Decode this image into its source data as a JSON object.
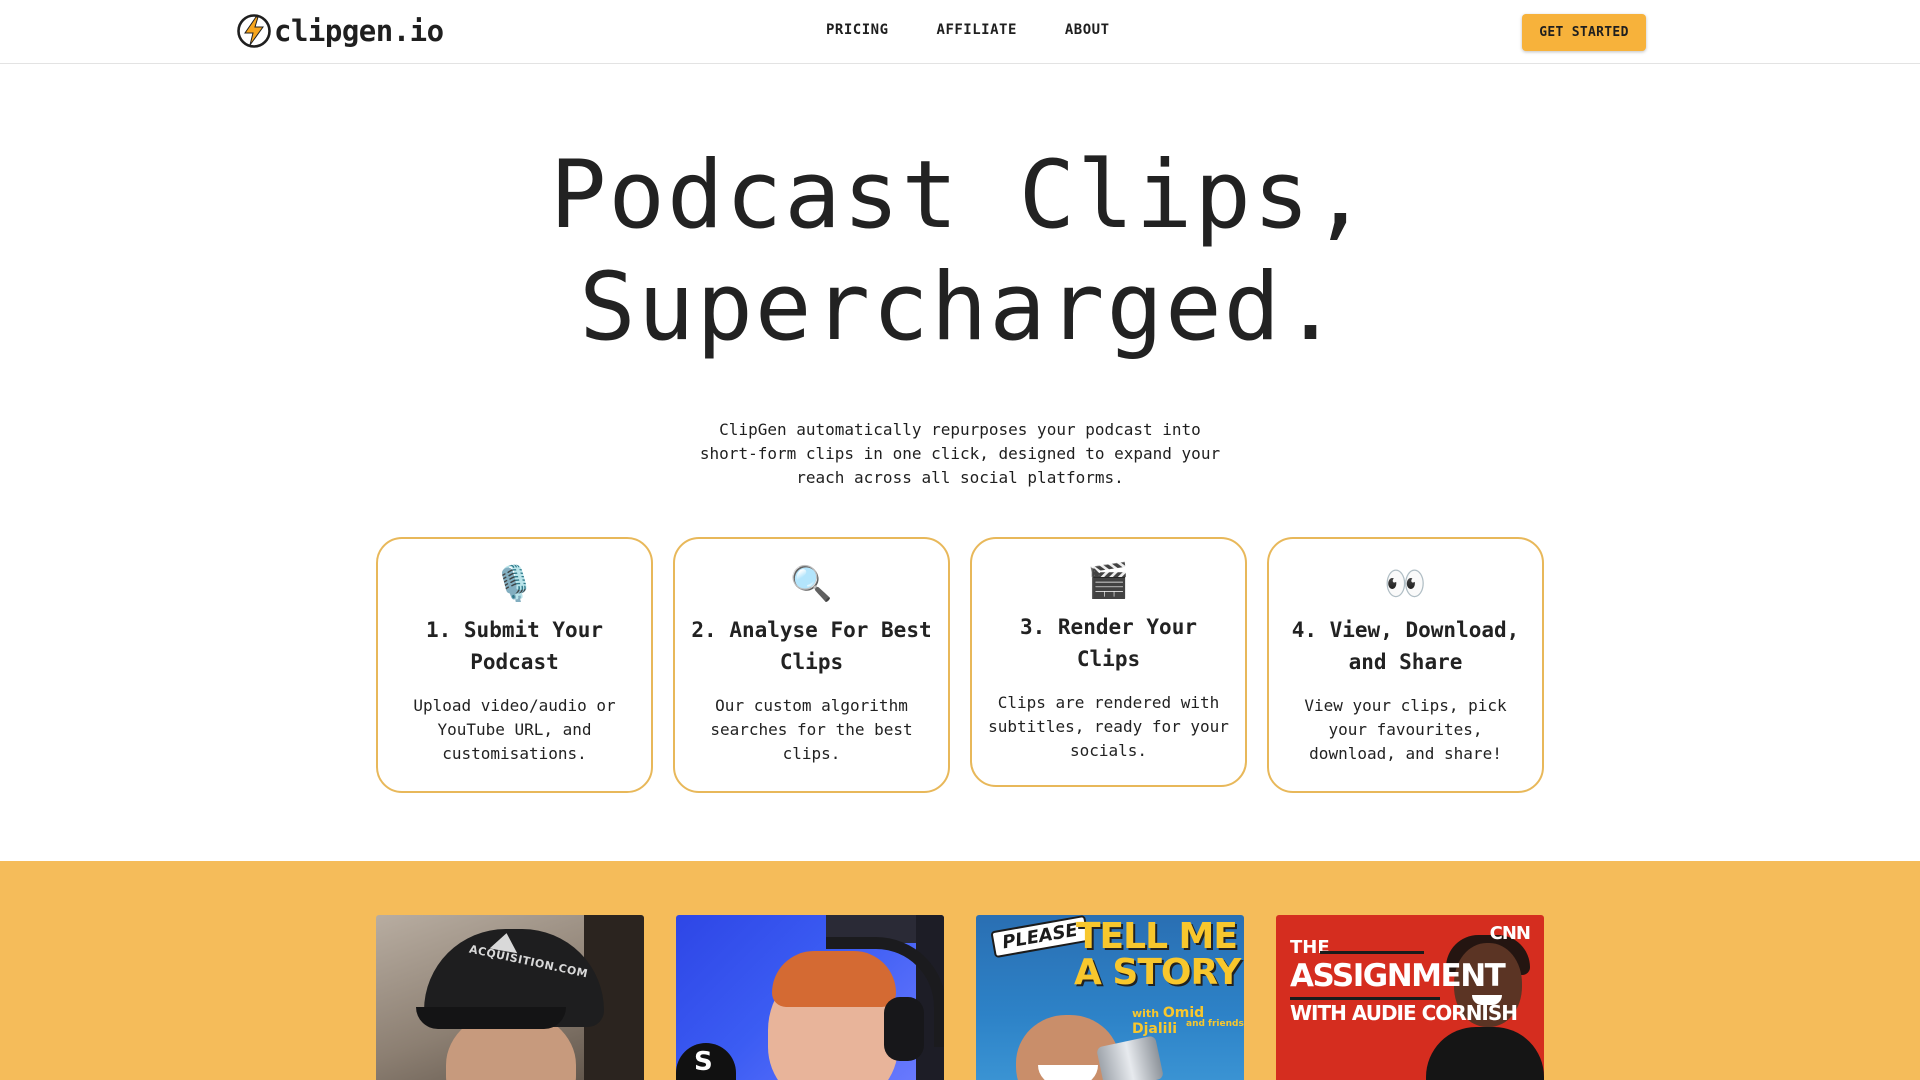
{
  "header": {
    "logo_text": "clipgen.io",
    "nav": [
      {
        "label": "PRICING"
      },
      {
        "label": "AFFILIATE"
      },
      {
        "label": "ABOUT"
      }
    ],
    "cta_label": "GET STARTED"
  },
  "hero": {
    "title_line1": "Podcast Clips,",
    "title_line2": "Supercharged.",
    "subtitle": "ClipGen automatically repurposes your podcast into short-form clips in one click, designed to expand your reach across all social platforms."
  },
  "steps": [
    {
      "icon": "microphone-icon",
      "emoji": "🎙️",
      "title": "1. Submit Your Podcast",
      "description": "Upload video/audio or YouTube URL, and customisations."
    },
    {
      "icon": "magnifier-icon",
      "emoji": "🔍",
      "title": "2. Analyse For Best Clips",
      "description": "Our custom algorithm searches for the best clips."
    },
    {
      "icon": "clapperboard-icon",
      "emoji": "🎬",
      "title": "3. Render Your Clips",
      "description": "Clips are rendered with subtitles, ready for your socials."
    },
    {
      "icon": "eyes-icon",
      "emoji": "👀",
      "title": "4. View, Download, and Share",
      "description": "View your clips, pick your favourites, download, and share!"
    }
  ],
  "gallery": {
    "background": "#f5bc5a",
    "thumbs": [
      {
        "cap_text": "ACQUISITION.COM"
      },
      {
        "sign_text": "S"
      },
      {
        "please": "PLEASE",
        "title1": "TELL ME",
        "title2": "A STORY",
        "with": "with",
        "host": "Omid Djalili",
        "friends": "and friends"
      },
      {
        "network": "CNN",
        "the": "THE",
        "title": "ASSIGNMENT",
        "with": "WITH AUDIE CORNISH"
      }
    ]
  },
  "colors": {
    "accent": "#f7b23b",
    "card_border": "#e8b85a"
  }
}
